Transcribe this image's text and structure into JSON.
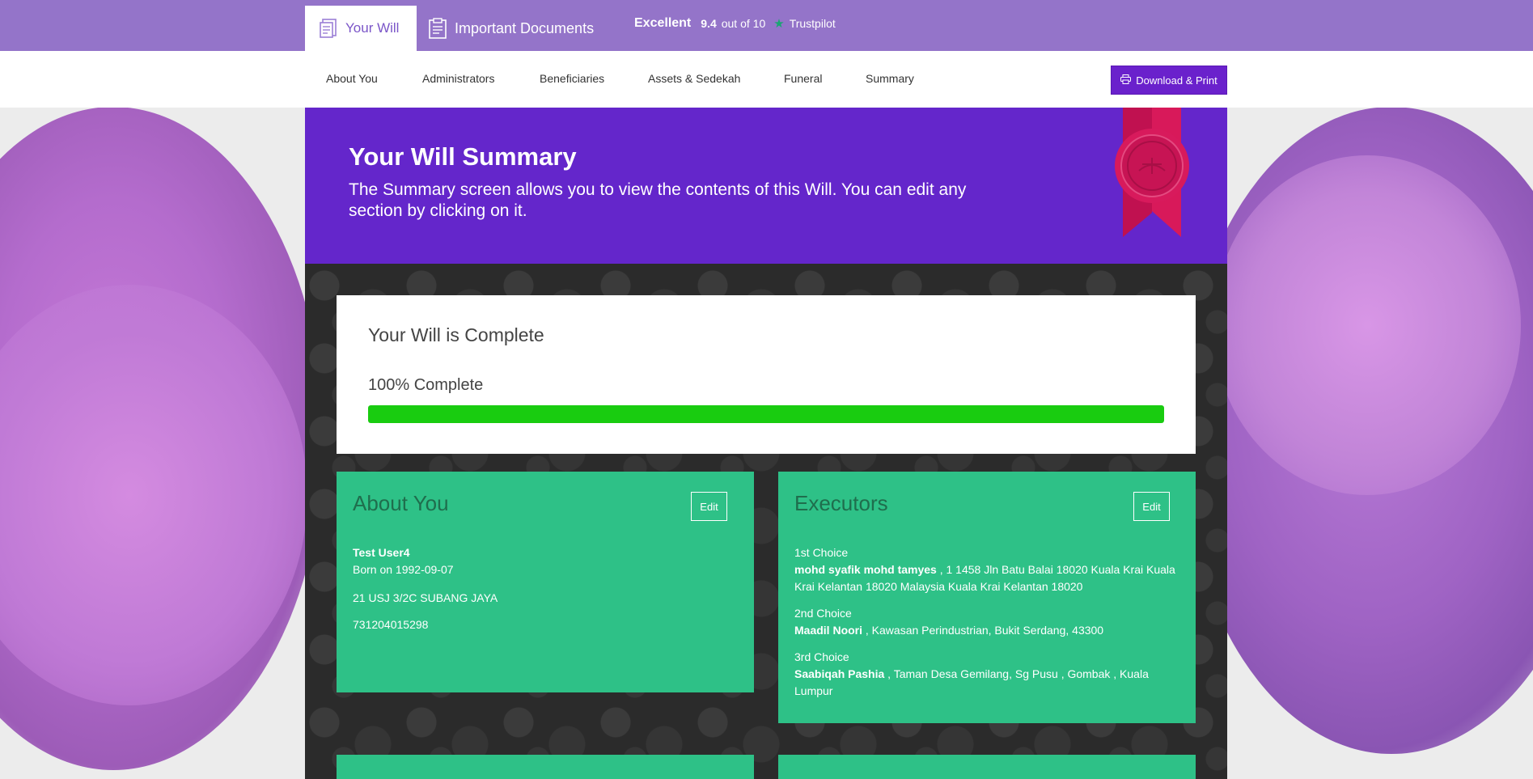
{
  "topbar": {
    "tabs": [
      {
        "label": "Your Will",
        "icon": "document-icon"
      },
      {
        "label": "Important Documents",
        "icon": "clipboard-icon"
      }
    ],
    "trustpilot": {
      "rating_word": "Excellent",
      "score": "9.4",
      "score_suffix": "out of 10",
      "brand": "Trustpilot"
    }
  },
  "nav": {
    "items": [
      "About You",
      "Administrators",
      "Beneficiaries",
      "Assets & Sedekah",
      "Funeral",
      "Summary"
    ],
    "download_label": "Download & Print"
  },
  "hero": {
    "title": "Your Will Summary",
    "description": "The Summary screen allows you to view the contents of this Will. You can edit any section by clicking on it."
  },
  "progress": {
    "title": "Your Will is Complete",
    "percent_label": "100% Complete",
    "percent": 100,
    "bar_color": "#19cc10"
  },
  "about_card": {
    "title": "About You",
    "edit_label": "Edit",
    "name": "Test User4",
    "born": "Born on 1992-09-07",
    "address": "21 USJ 3/2C SUBANG JAYA",
    "ic": "731204015298"
  },
  "executors_card": {
    "title": "Executors",
    "edit_label": "Edit",
    "choices": [
      {
        "rank": "1st Choice",
        "name": "mohd syafik mohd tamyes",
        "address": ", 1 1458 Jln Batu Balai 18020 Kuala Krai Kuala Krai Kelantan 18020 Malaysia Kuala Krai Kelantan 18020"
      },
      {
        "rank": "2nd Choice",
        "name": "Maadil Noori",
        "address": ", Kawasan Perindustrian, Bukit Serdang, 43300"
      },
      {
        "rank": "3rd Choice",
        "name": "Saabiqah Pashia",
        "address": ", Taman Desa Gemilang, Sg Pusu , Gombak , Kuala Lumpur"
      }
    ]
  },
  "colors": {
    "topbar": "#9474c9",
    "hero": "#6426cb",
    "card": "#2ec187",
    "download": "#6a21cc"
  }
}
